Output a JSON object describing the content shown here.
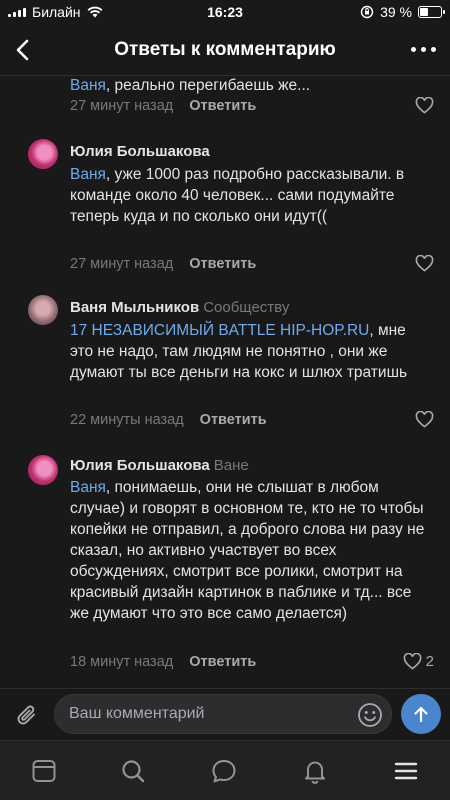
{
  "status_bar": {
    "carrier": "Билайн",
    "time": "16:23",
    "battery_text": "39 %",
    "battery_level": 0.39
  },
  "header": {
    "title": "Ответы к комментарию"
  },
  "reply_label": "Ответить",
  "comments": [
    {
      "mention": "Ваня",
      "text": ", реально перегибаешь же...",
      "time": "27 минут назад"
    },
    {
      "author": "Юлия Большакова",
      "mention": "Ваня",
      "text": ", уже 1000 раз подробно рассказывали. в команде около 40 человек... сами подумайте теперь куда и по сколько они идут((",
      "time": "27 минут назад"
    },
    {
      "author": "Ваня Мыльников",
      "reply_to": "Сообществу",
      "mention": "17 НЕЗАВИСИМЫЙ BATTLE HIP-HOP.RU",
      "text": ", мне это не надо, там людям не понятно , они же думают ты все деньги на кокс и шлюх тратишь",
      "time": "22 минуты назад"
    },
    {
      "author": "Юлия Большакова",
      "reply_to": "Ване",
      "mention": "Ваня",
      "text": ", понимаешь, они не слышат в любом случае) и говорят в основном те, кто не то чтобы копейки не отправил, а доброго слова ни разу не сказал, но активно участвует во всех обсуждениях, смотрит все ролики, смотрит на красивый дизайн картинок в паблике и тд... все же думают что это все само делается)",
      "time": "18 минут назад",
      "likes": "2"
    }
  ],
  "composer": {
    "placeholder": "Ваш комментарий"
  },
  "icons": {
    "back": "chevron-left-icon",
    "more": "more-dots-icon",
    "like": "heart-icon",
    "attach": "paperclip-icon",
    "emoji": "smile-icon",
    "send": "send-arrow-icon",
    "tabs": [
      "news-icon",
      "search-icon",
      "messages-icon",
      "notifications-icon",
      "menu-icon"
    ]
  },
  "colors": {
    "background": "#19191a",
    "accent": "#71aaeb",
    "send_button": "#4986cc"
  }
}
